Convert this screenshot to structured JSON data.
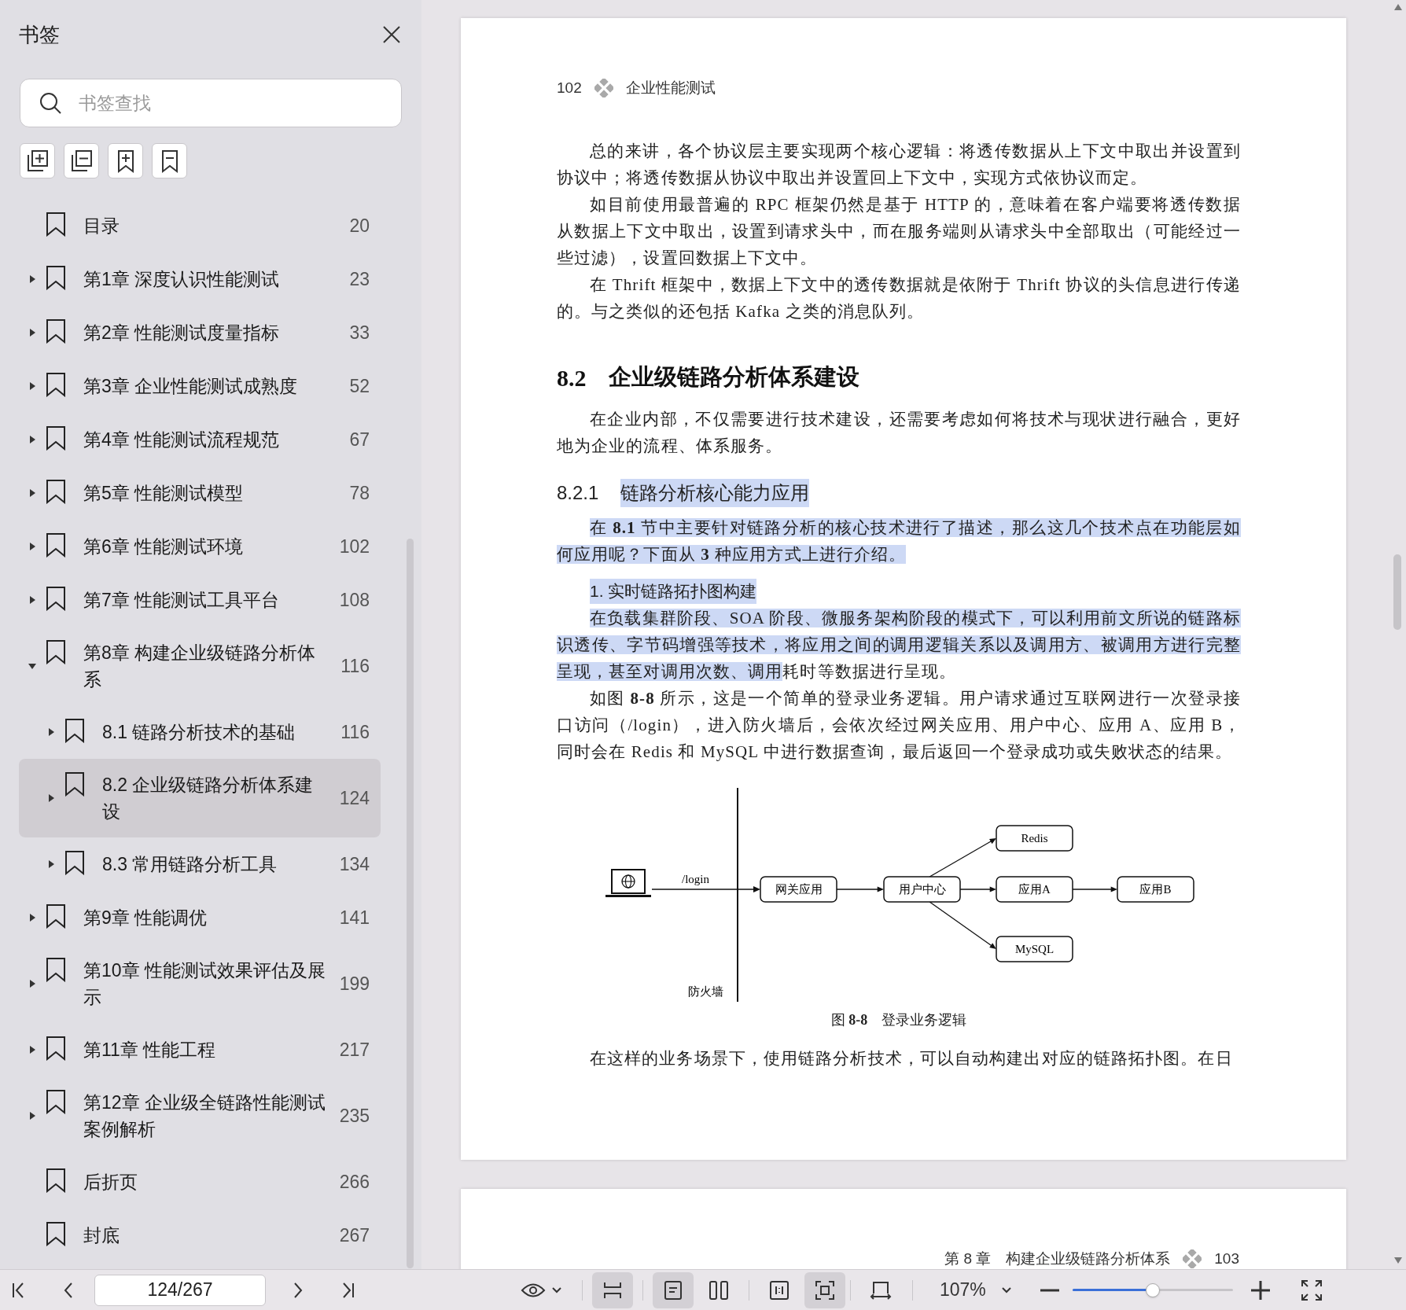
{
  "sidebar": {
    "title": "书签",
    "search": {
      "placeholder": "书签查找"
    },
    "items": [
      {
        "label": "目录",
        "page": "20",
        "expandable": false,
        "selected": false
      },
      {
        "label": "第1章 深度认识性能测试",
        "page": "23",
        "expandable": true,
        "expanded": false,
        "selected": false
      },
      {
        "label": "第2章 性能测试度量指标",
        "page": "33",
        "expandable": true,
        "expanded": false,
        "selected": false
      },
      {
        "label": "第3章 企业性能测试成熟度",
        "page": "52",
        "expandable": true,
        "expanded": false,
        "selected": false
      },
      {
        "label": "第4章 性能测试流程规范",
        "page": "67",
        "expandable": true,
        "expanded": false,
        "selected": false
      },
      {
        "label": "第5章 性能测试模型",
        "page": "78",
        "expandable": true,
        "expanded": false,
        "selected": false
      },
      {
        "label": "第6章 性能测试环境",
        "page": "102",
        "expandable": true,
        "expanded": false,
        "selected": false
      },
      {
        "label": "第7章 性能测试工具平台",
        "page": "108",
        "expandable": true,
        "expanded": false,
        "selected": false
      },
      {
        "label": "第8章 构建企业级链路分析体系",
        "page": "116",
        "expandable": true,
        "expanded": true,
        "selected": false,
        "children": [
          {
            "label": "8.1 链路分析技术的基础",
            "page": "116",
            "expandable": true,
            "expanded": false,
            "selected": false
          },
          {
            "label": "8.2 企业级链路分析体系建设",
            "page": "124",
            "expandable": true,
            "expanded": false,
            "selected": true
          },
          {
            "label": "8.3 常用链路分析工具",
            "page": "134",
            "expandable": true,
            "expanded": false,
            "selected": false
          }
        ]
      },
      {
        "label": "第9章 性能调优",
        "page": "141",
        "expandable": true,
        "expanded": false,
        "selected": false
      },
      {
        "label": "第10章 性能测试效果评估及展示",
        "page": "199",
        "expandable": true,
        "expanded": false,
        "selected": false
      },
      {
        "label": "第11章 性能工程",
        "page": "217",
        "expandable": true,
        "expanded": false,
        "selected": false
      },
      {
        "label": "第12章 企业级全链路性能测试案例解析",
        "page": "235",
        "expandable": true,
        "expanded": false,
        "selected": false
      },
      {
        "label": "后折页",
        "page": "266",
        "expandable": false,
        "selected": false
      },
      {
        "label": "封底",
        "page": "267",
        "expandable": false,
        "selected": false
      }
    ]
  },
  "document": {
    "pages": [
      {
        "header": {
          "number": "102",
          "title": "企业性能测试"
        },
        "blocks": [
          {
            "kind": "paragraph",
            "segments": [
              {
                "text": "总的来讲，各个协议层主要实现两个核心逻辑：将透传数据从上下文中取出并设置到协议中；将透传数据从协议中取出并设置回上下文中，实现方式依协议而定。",
                "highlighted": false
              }
            ]
          },
          {
            "kind": "paragraph",
            "segments": [
              {
                "text": "如目前使用最普遍的 RPC 框架仍然是基于 HTTP 的，意味着在客户端要将透传数据从数据上下文中取出，设置到请求头中，而在服务端则从请求头中全部取出（可能经过一些过滤），设置回数据上下文中。",
                "highlighted": false
              }
            ]
          },
          {
            "kind": "paragraph",
            "segments": [
              {
                "text": "在 Thrift 框架中，数据上下文中的透传数据就是依附于 Thrift 协议的头信息进行传递的。与之类似的还包括 Kafka 之类的消息队列。",
                "highlighted": false
              }
            ]
          },
          {
            "kind": "section",
            "number": "8.2",
            "text": "企业级链路分析体系建设"
          },
          {
            "kind": "paragraph",
            "segments": [
              {
                "text": "在企业内部，不仅需要进行技术建设，还需要考虑如何将技术与现状进行融合，更好地为企业的流程、体系服务。",
                "highlighted": false
              }
            ]
          },
          {
            "kind": "subsection",
            "number": "8.2.1",
            "text": "链路分析核心能力应用",
            "highlighted": true
          },
          {
            "kind": "paragraph",
            "segments": [
              {
                "text": "在 **8.1** 节中主要针对链路分析的核心技术进行了描述，那么这几个技术点在功能层如何应用呢？下面从 **3** 种应用方式上进行介绍。",
                "highlighted": true
              }
            ]
          },
          {
            "kind": "topic",
            "text": "1. 实时链路拓扑图构建",
            "highlighted": true
          },
          {
            "kind": "paragraph",
            "segments": [
              {
                "text": "在负载集群阶段、SOA 阶段、微服务架构阶段的模式下，可以利用前文所说的链路标识透传、字节码增强等技术，将应用之间的调用逻辑关系以及调用方、被调用方进行完整呈现，甚至对调用次数、调用",
                "highlighted": true
              },
              {
                "text": "耗时等数据进行呈现。",
                "highlighted": false
              }
            ]
          },
          {
            "kind": "paragraph",
            "segments": [
              {
                "text": "如图 **8-8** 所示，这是一个简单的登录业务逻辑。用户请求通过互联网进行一次登录接口访问（/login），进入防火墙后，会依次经过网关应用、用户中心、应用 A、应用 B，同时会在 Redis 和 MySQL 中进行数据查询，最后返回一个登录成功或失败状态的结果。",
                "highlighted": false
              }
            ]
          },
          {
            "kind": "figure",
            "login": "/login",
            "firewall": "防火墙",
            "nodes": [
              "网关应用",
              "用户中心",
              "应用A",
              "应用B",
              "Redis",
              "MySQL"
            ]
          },
          {
            "kind": "caption",
            "text": "图 **8-8**　登录业务逻辑"
          },
          {
            "kind": "paragraph",
            "segments": [
              {
                "text": "在这样的业务场景下，使用链路分析技术，可以自动构建出对应的链路拓扑图。在日",
                "highlighted": false
              }
            ]
          }
        ]
      },
      {
        "footer": {
          "title": "第 8 章　构建企业级链路分析体系",
          "number": "103"
        }
      }
    ]
  },
  "toolbar": {
    "page_field": "124/267",
    "view_buttons": [
      {
        "kind": "scroll",
        "selected": true
      },
      {
        "kind": "single",
        "selected": true
      },
      {
        "kind": "double",
        "selected": false
      },
      {
        "kind": "actual",
        "selected": false
      },
      {
        "kind": "fit",
        "selected": true
      },
      {
        "kind": "rotate",
        "selected": false
      }
    ],
    "zoom": "107%",
    "zoom_slider": {
      "level": 0.5
    }
  }
}
